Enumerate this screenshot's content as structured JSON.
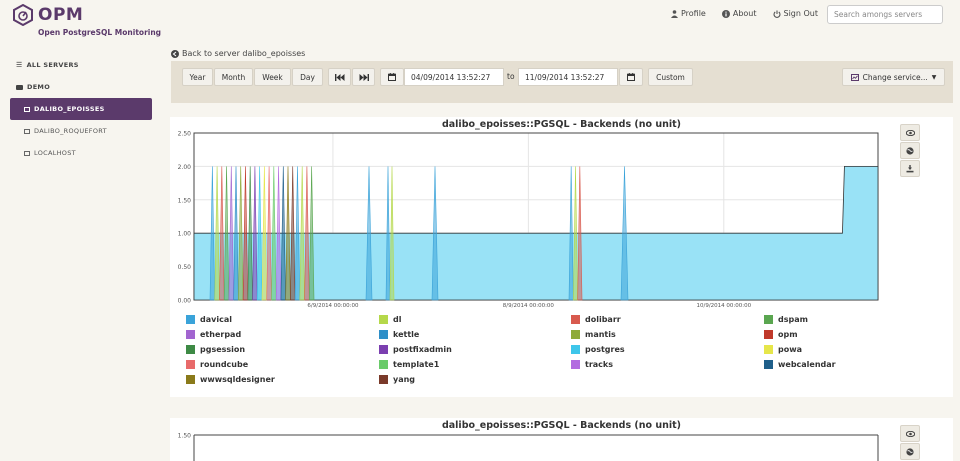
{
  "app": {
    "name": "OPM",
    "tagline": "Open PostgreSQL Monitoring",
    "brand_color": "#5b3a6b"
  },
  "topnav": {
    "profile": "Profile",
    "about": "About",
    "signout": "Sign Out",
    "search_placeholder": "Search amongs servers"
  },
  "sidebar": {
    "all_servers": "ALL SERVERS",
    "group": "DEMO",
    "servers": [
      {
        "label": "DALIBO_EPOISSES",
        "active": true
      },
      {
        "label": "DALIBO_ROQUEFORT",
        "active": false
      },
      {
        "label": "LOCALHOST",
        "active": false
      }
    ]
  },
  "back_link": "Back to server dalibo_epoisses",
  "toolbar": {
    "year": "Year",
    "month": "Month",
    "week": "Week",
    "day": "Day",
    "from_date": "04/09/2014 13:52:27",
    "to_label": "to",
    "to_date": "11/09/2014 13:52:27",
    "custom": "Custom",
    "change_service": "Change service..."
  },
  "chart_data": [
    {
      "type": "area",
      "title": "dalibo_epoisses::PGSQL - Backends (no unit)",
      "yticks": [
        "2.50",
        "2.00",
        "1.50",
        "1.00",
        "0.50",
        "0.00"
      ],
      "ylim": [
        0,
        2.5
      ],
      "xticks": [
        "6/9/2014 00:00:00",
        "8/9/2014 00:00:00",
        "10/9/2014 00:00:00"
      ],
      "xlim": [
        "2014-09-04 13:52:27",
        "2014-09-11 13:52:27"
      ],
      "grid": true,
      "legend_position": "bottom",
      "series_color": "#99e2f6",
      "baseline_value": 1,
      "final_value": 2,
      "legend": [
        {
          "name": "davical",
          "color": "#3aa3d9"
        },
        {
          "name": "dl",
          "color": "#b5d84a"
        },
        {
          "name": "dolibarr",
          "color": "#d85a4e"
        },
        {
          "name": "dspam",
          "color": "#5aa650"
        },
        {
          "name": "etherpad",
          "color": "#a265d0"
        },
        {
          "name": "kettle",
          "color": "#2e8fc8"
        },
        {
          "name": "mantis",
          "color": "#8faa3a"
        },
        {
          "name": "opm",
          "color": "#c0392b"
        },
        {
          "name": "pgsession",
          "color": "#3e8a45"
        },
        {
          "name": "postfixadmin",
          "color": "#7b3fb0"
        },
        {
          "name": "postgres",
          "color": "#3ec6ea"
        },
        {
          "name": "powa",
          "color": "#e6e64a"
        },
        {
          "name": "roundcube",
          "color": "#e86a6a"
        },
        {
          "name": "template1",
          "color": "#6acb6a"
        },
        {
          "name": "tracks",
          "color": "#b26be0"
        },
        {
          "name": "webcalendar",
          "color": "#1f5f8a"
        },
        {
          "name": "wwwsqldesigner",
          "color": "#8a7a1a"
        },
        {
          "name": "yang",
          "color": "#7a3a2a"
        }
      ]
    },
    {
      "type": "area",
      "title": "dalibo_epoisses::PGSQL - Backends (no unit)",
      "yticks": [
        "1.50"
      ],
      "ylim": [
        0,
        1.5
      ]
    }
  ]
}
